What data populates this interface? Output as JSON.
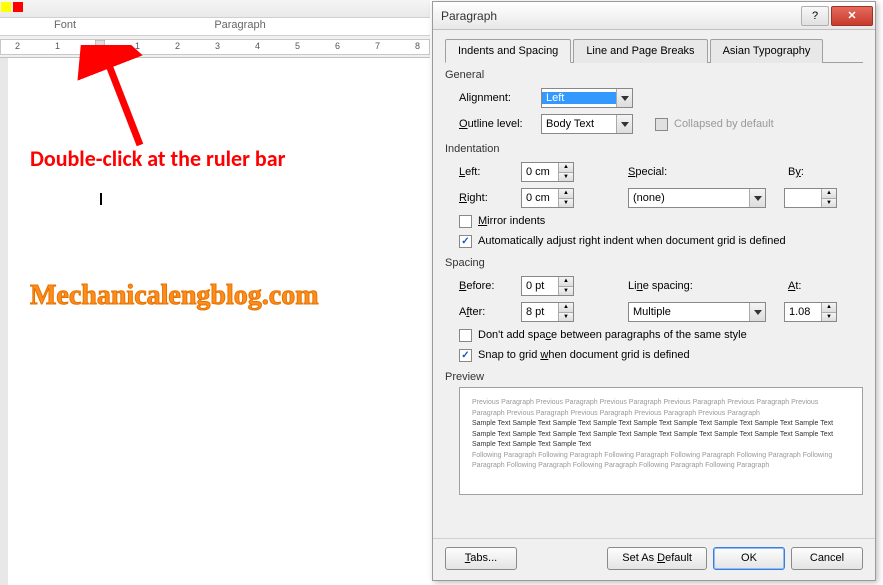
{
  "ribbon": {
    "group_font": "Font",
    "group_paragraph": "Paragraph"
  },
  "annotation": "Double-click at the ruler bar",
  "watermark": "Mechanicalengblog.com",
  "dialog": {
    "title": "Paragraph",
    "tabs": {
      "indents": "Indents and Spacing",
      "line_breaks": "Line and Page Breaks",
      "asian": "Asian Typography"
    },
    "general": {
      "title": "General",
      "alignment_label": "Alignment:",
      "alignment_value": "Left",
      "outline_label": "Outline level:",
      "outline_value": "Body Text",
      "collapsed_label": "Collapsed by default"
    },
    "indentation": {
      "title": "Indentation",
      "left_label": "Left:",
      "left_value": "0 cm",
      "right_label": "Right:",
      "right_value": "0 cm",
      "special_label": "Special:",
      "special_value": "(none)",
      "by_label": "By:",
      "by_value": "",
      "mirror_label": "Mirror indents",
      "auto_adjust_label": "Automatically adjust right indent when document grid is defined"
    },
    "spacing": {
      "title": "Spacing",
      "before_label": "Before:",
      "before_value": "0 pt",
      "after_label": "After:",
      "after_value": "8 pt",
      "line_spacing_label": "Line spacing:",
      "line_spacing_value": "Multiple",
      "at_label": "At:",
      "at_value": "1.08",
      "dont_add_label": "Don't add space between paragraphs of the same style",
      "snap_label": "Snap to grid when document grid is defined"
    },
    "preview": {
      "title": "Preview",
      "prev_text": "Previous Paragraph Previous Paragraph Previous Paragraph Previous Paragraph Previous Paragraph Previous Paragraph Previous Paragraph Previous Paragraph Previous Paragraph Previous Paragraph",
      "sample_text": "Sample Text Sample Text Sample Text Sample Text Sample Text Sample Text Sample Text Sample Text Sample Text Sample Text Sample Text Sample Text Sample Text Sample Text Sample Text Sample Text Sample Text Sample Text Sample Text Sample Text Sample Text",
      "follow_text": "Following Paragraph Following Paragraph Following Paragraph Following Paragraph Following Paragraph Following Paragraph Following Paragraph Following Paragraph Following Paragraph Following Paragraph"
    },
    "buttons": {
      "tabs": "Tabs...",
      "set_default": "Set As Default",
      "ok": "OK",
      "cancel": "Cancel"
    }
  },
  "ruler_numbers": [
    "2",
    "1",
    "1",
    "2",
    "3",
    "4",
    "5",
    "6",
    "7",
    "8"
  ]
}
